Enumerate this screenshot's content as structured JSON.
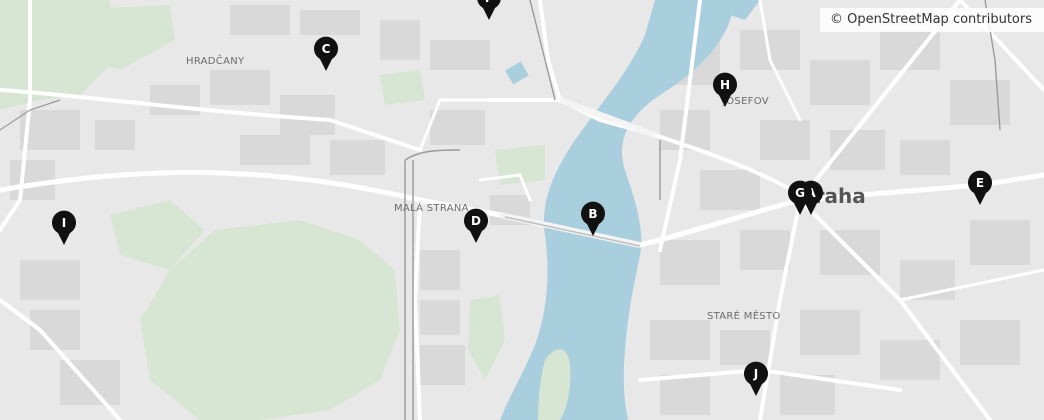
{
  "attribution": "© OpenStreetMap contributors",
  "places": {
    "hradcany": "HRADČANY",
    "mala_strana": "MALÁ STRANA",
    "josefov": "JOSEFOV",
    "praha": "Praha",
    "stare_mesto": "STARÉ MĚSTO"
  },
  "markers": {
    "a": "A",
    "b": "B",
    "c": "C",
    "d": "D",
    "e": "E",
    "f": "F",
    "g": "G",
    "h": "H",
    "i": "I",
    "j": "J"
  },
  "colors": {
    "water": "#a9cede",
    "park": "#d6e5d2",
    "land": "#e9e9e9",
    "block": "#d9d9d9",
    "road": "#ffffff",
    "rail": "#9a9a9a",
    "marker": "#111111"
  }
}
